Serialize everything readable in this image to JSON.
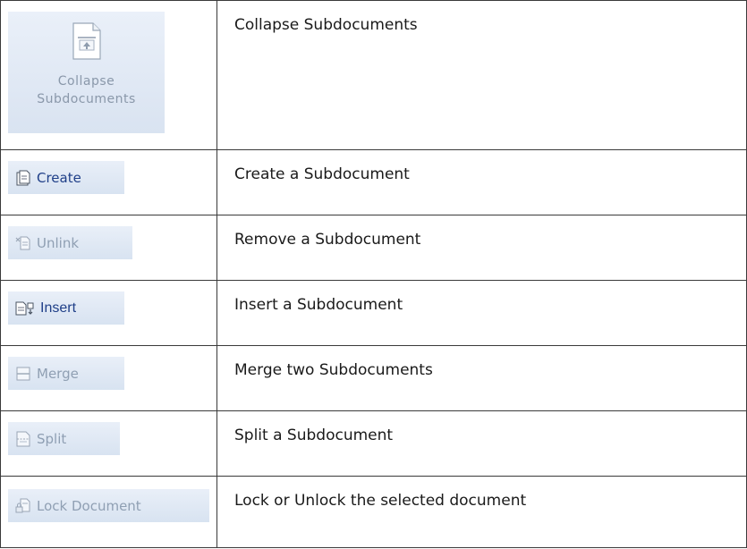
{
  "rows": [
    {
      "button_label_1": "Collapse",
      "button_label_2": "Subdocuments",
      "icon": "collapse-subdocuments-icon",
      "description": "Collapse Subdocuments"
    },
    {
      "button_label": "Create",
      "icon": "create-subdocument-icon",
      "description": "Create a Subdocument",
      "enabled": true
    },
    {
      "button_label": "Unlink",
      "icon": "unlink-subdocument-icon",
      "description": "Remove a Subdocument",
      "enabled": false
    },
    {
      "button_label": "Insert",
      "icon": "insert-subdocument-icon",
      "description": "Insert a Subdocument",
      "enabled": true
    },
    {
      "button_label": "Merge",
      "icon": "merge-subdocuments-icon",
      "description": "Merge two Subdocuments",
      "enabled": false
    },
    {
      "button_label": "Split",
      "icon": "split-subdocument-icon",
      "description": "Split a Subdocument",
      "enabled": false
    },
    {
      "button_label": "Lock Document",
      "icon": "lock-document-icon",
      "description": "Lock or Unlock the selected document",
      "enabled": false
    }
  ],
  "colors": {
    "enabled_text": "#1f3f88",
    "disabled_text": "#8f9fb3",
    "button_bg": "#dfe8f4",
    "border": "#3a3a3a"
  }
}
